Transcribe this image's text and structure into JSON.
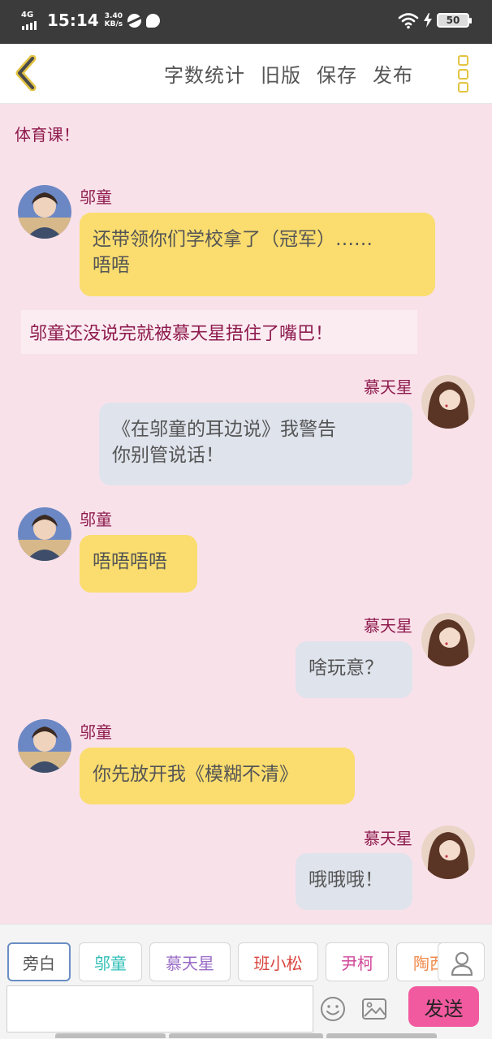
{
  "status_bar": {
    "network": "4G",
    "time": "15:14",
    "speed_value": "3.40",
    "speed_unit": "KB/s",
    "battery": "50",
    "icons": [
      "signal-icon",
      "browser-icon",
      "message-icon",
      "wifi-icon",
      "charging-icon",
      "battery-icon"
    ]
  },
  "top_bar": {
    "back_icon": "chevron-left-icon",
    "actions": [
      "字数统计",
      "旧版",
      "保存",
      "发布"
    ],
    "more_icon": "more-vertical-icon",
    "accent_color": "#e3c443"
  },
  "chat": {
    "messages": [
      {
        "type": "narration",
        "text": "体育课！"
      },
      {
        "type": "message",
        "side": "left",
        "name": "邬童",
        "lines": [
          "还带领你们学校拿了（冠军）……",
          "唔唔"
        ]
      },
      {
        "type": "narration",
        "text": "邬童还没说完就被慕天星捂住了嘴巴！"
      },
      {
        "type": "message",
        "side": "right",
        "name": "慕天星",
        "lines": [
          "《在邬童的耳边说》我警告",
          "你别管说话！"
        ]
      },
      {
        "type": "message",
        "side": "left",
        "name": "邬童",
        "lines": [
          "唔唔唔唔"
        ]
      },
      {
        "type": "message",
        "side": "right",
        "name": "慕天星",
        "lines": [
          "啥玩意？"
        ]
      },
      {
        "type": "message",
        "side": "left",
        "name": "邬童",
        "lines": [
          "你先放开我《模糊不清》"
        ]
      },
      {
        "type": "message",
        "side": "right",
        "name": "慕天星",
        "lines": [
          "哦哦哦！"
        ]
      }
    ],
    "colors": {
      "background": "#f9e1ea",
      "name": "#8e1b4d",
      "left_bubble": "#fadd6e",
      "right_bubble": "#dfe3ec"
    }
  },
  "bottom": {
    "roles": [
      {
        "label": "旁白",
        "color": "#555555",
        "active": true
      },
      {
        "label": "邬童",
        "color": "#2fbfb6"
      },
      {
        "label": "慕天星",
        "color": "#9a6cc7"
      },
      {
        "label": "班小松",
        "color": "#d9453f"
      },
      {
        "label": "尹柯",
        "color": "#d0479a"
      },
      {
        "label": "陶西",
        "color": "#f08a4b"
      }
    ],
    "user_icon": "user-icon",
    "input_value": "",
    "emoji_icon": "emoji-icon",
    "image_icon": "image-icon",
    "send_label": "发送",
    "send_color": "#f25a9f"
  }
}
